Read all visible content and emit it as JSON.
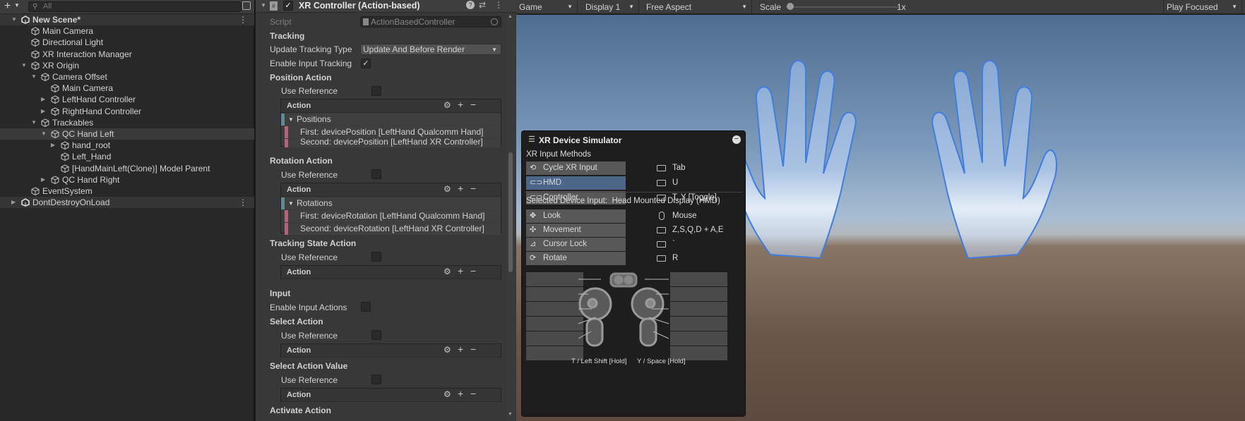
{
  "hierarchy": {
    "search_placeholder": "All",
    "items": [
      {
        "label": "New Scene*",
        "indent": 0,
        "arrow": "down",
        "type": "scene"
      },
      {
        "label": "Main Camera",
        "indent": 1,
        "arrow": "",
        "type": "obj"
      },
      {
        "label": "Directional Light",
        "indent": 1,
        "arrow": "",
        "type": "obj"
      },
      {
        "label": "XR Interaction Manager",
        "indent": 1,
        "arrow": "",
        "type": "obj"
      },
      {
        "label": "XR Origin",
        "indent": 1,
        "arrow": "down",
        "type": "obj"
      },
      {
        "label": "Camera Offset",
        "indent": 2,
        "arrow": "down",
        "type": "obj"
      },
      {
        "label": "Main Camera",
        "indent": 3,
        "arrow": "",
        "type": "obj"
      },
      {
        "label": "LeftHand Controller",
        "indent": 3,
        "arrow": "right",
        "type": "obj"
      },
      {
        "label": "RightHand Controller",
        "indent": 3,
        "arrow": "right",
        "type": "obj"
      },
      {
        "label": "Trackables",
        "indent": 2,
        "arrow": "down",
        "type": "obj"
      },
      {
        "label": "QC Hand Left",
        "indent": 3,
        "arrow": "down",
        "type": "obj",
        "selected": true
      },
      {
        "label": "hand_root",
        "indent": 4,
        "arrow": "right",
        "type": "obj"
      },
      {
        "label": "Left_Hand",
        "indent": 4,
        "arrow": "",
        "type": "obj"
      },
      {
        "label": "[HandMainLeft(Clone)] Model Parent",
        "indent": 4,
        "arrow": "",
        "type": "obj"
      },
      {
        "label": "QC Hand Right",
        "indent": 3,
        "arrow": "right",
        "type": "obj"
      },
      {
        "label": "EventSystem",
        "indent": 1,
        "arrow": "",
        "type": "obj"
      },
      {
        "label": "DontDestroyOnLoad",
        "indent": 0,
        "arrow": "right",
        "type": "scene"
      }
    ]
  },
  "inspector": {
    "component_title": "XR Controller (Action-based)",
    "script_label": "Script",
    "script_value": "ActionBasedController",
    "tracking_header": "Tracking",
    "update_tracking_label": "Update Tracking Type",
    "update_tracking_value": "Update And Before Render",
    "enable_input_tracking_label": "Enable Input Tracking",
    "position_action_header": "Position Action",
    "use_reference_label": "Use Reference",
    "action_label": "Action",
    "positions_label": "Positions",
    "position_first": "First: devicePosition [LeftHand Qualcomm Hand]",
    "position_second": "Second: devicePosition [LeftHand XR Controller]",
    "rotation_action_header": "Rotation Action",
    "rotations_label": "Rotations",
    "rotation_first": "First: deviceRotation [LeftHand Qualcomm Hand]",
    "rotation_second": "Second: deviceRotation [LeftHand XR Controller]",
    "tracking_state_header": "Tracking State Action",
    "input_header": "Input",
    "enable_input_actions_label": "Enable Input Actions",
    "select_action_header": "Select Action",
    "select_action_value_header": "Select Action Value",
    "activate_action_header": "Activate Action"
  },
  "game_toolbar": {
    "view": "Game",
    "display": "Display 1",
    "aspect": "Free Aspect",
    "scale_label": "Scale",
    "scale_value": "1x",
    "play_mode": "Play Focused"
  },
  "simulator": {
    "title": "XR Device Simulator",
    "methods_header": "XR Input Methods",
    "methods": [
      {
        "label": "Cycle XR Input",
        "key": "Tab",
        "icon": "cycle-icon",
        "active": false
      },
      {
        "label": "HMD",
        "key": "U",
        "icon": "hmd-icon",
        "active": true
      },
      {
        "label": "Controller",
        "key": "T, Y [Toggle]",
        "icon": "controller-icon",
        "active": false
      }
    ],
    "selected_label": "Selected Device Input:",
    "selected_value": "Head Mounted Display (HMD)",
    "inputs": [
      {
        "label": "Look",
        "key": "Mouse",
        "icon": "look-icon"
      },
      {
        "label": "Movement",
        "key": "Z,S,Q,D + A,E",
        "icon": "move-icon"
      },
      {
        "label": "Cursor Lock",
        "key": "`",
        "icon": "cursor-icon"
      },
      {
        "label": "Rotate",
        "key": "R",
        "icon": "rotate-icon"
      }
    ],
    "footer_left": "T / Left Shift [Hold]",
    "footer_right": "Y / Space [Hold]"
  },
  "colors": {
    "accent_selection": "#4b6687",
    "binding_stripe_pink": "#b5637a",
    "binding_stripe_teal": "#5b8c96"
  }
}
